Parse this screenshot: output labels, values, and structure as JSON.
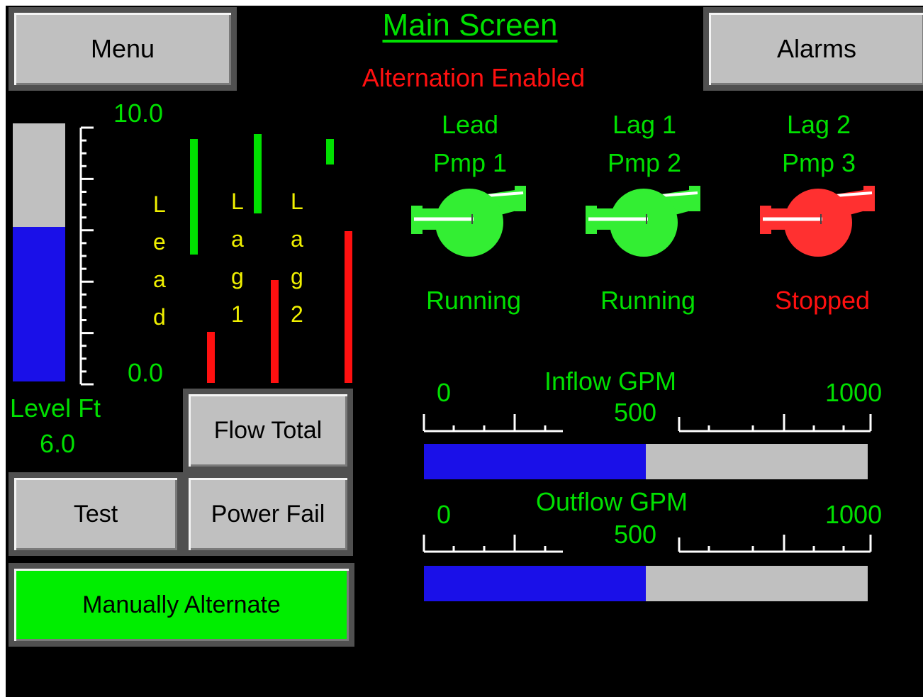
{
  "header": {
    "title": "Main Screen",
    "status": "Alternation Enabled",
    "menu_label": "Menu",
    "alarms_label": "Alarms"
  },
  "level": {
    "scale_max": "10.0",
    "scale_min": "0.0",
    "label": "Level Ft",
    "value": "6.0",
    "value_num": 6.0,
    "range": [
      0,
      10
    ]
  },
  "setpoints": [
    {
      "label_chars": [
        "L",
        "e",
        "a",
        "d"
      ],
      "on_top": 9.5,
      "on_bottom": 5.0,
      "off_level": 2.0
    },
    {
      "label_chars": [
        "L",
        "a",
        "g",
        "1"
      ],
      "on_top": 9.7,
      "on_bottom": 6.6,
      "off_level": 4.0
    },
    {
      "label_chars": [
        "L",
        "a",
        "g",
        "2"
      ],
      "on_top": 9.5,
      "on_bottom": 8.5,
      "off_level": 5.9
    }
  ],
  "pumps": [
    {
      "role": "Lead",
      "name": "Pmp 1",
      "status": "Running",
      "color": "#33ee33"
    },
    {
      "role": "Lag 1",
      "name": "Pmp 2",
      "status": "Running",
      "color": "#33ee33"
    },
    {
      "role": "Lag 2",
      "name": "Pmp 3",
      "status": "Stopped",
      "color": "#ff3030"
    }
  ],
  "meters": [
    {
      "title": "Inflow GPM",
      "min": "0",
      "mid": "500",
      "max": "1000",
      "value": 500,
      "fraction": 0.5
    },
    {
      "title": "Outflow GPM",
      "min": "0",
      "mid": "500",
      "max": "1000",
      "value": 500,
      "fraction": 0.5
    }
  ],
  "buttons": {
    "flow_total": "Flow Total",
    "test": "Test",
    "power_fail": "Power Fail",
    "manual_alternate": "Manually Alternate"
  },
  "colors": {
    "on": "#00e000",
    "off": "#ff1010",
    "label": "#f0f000",
    "fill": "#1a10e8",
    "empty": "#c0c0c0"
  }
}
